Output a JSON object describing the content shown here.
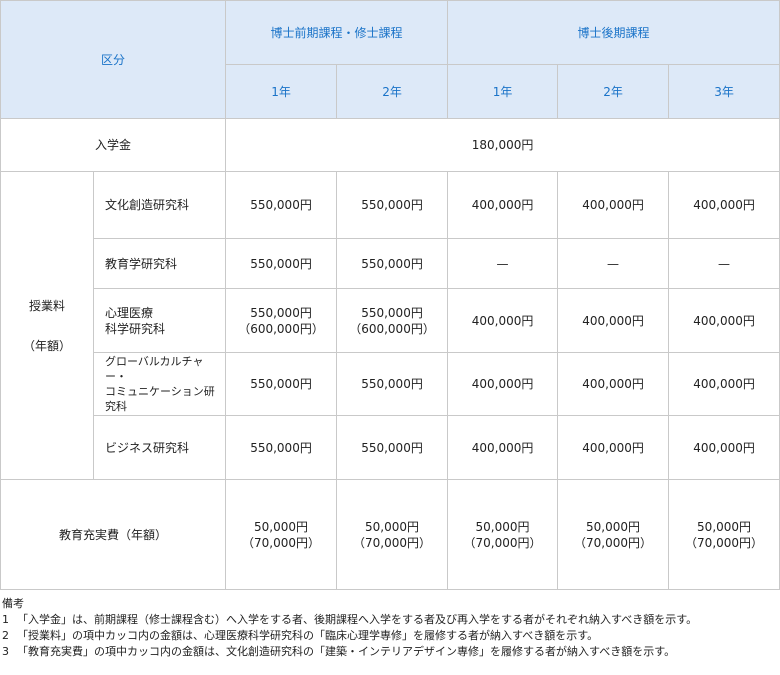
{
  "header": {
    "category": "区分",
    "masters_group": "博士前期課程・修士課程",
    "doctoral_group": "博士後期課程",
    "years": [
      "1年",
      "2年",
      "1年",
      "2年",
      "3年"
    ]
  },
  "admission": {
    "label": "入学金",
    "value": "180,000円"
  },
  "tuition": {
    "label": "授業料",
    "sublabel": "（年額）",
    "rows": [
      {
        "name": "文化創造研究科",
        "cells": [
          {
            "main": "550,000円",
            "alt": ""
          },
          {
            "main": "550,000円",
            "alt": ""
          },
          {
            "main": "400,000円",
            "alt": ""
          },
          {
            "main": "400,000円",
            "alt": ""
          },
          {
            "main": "400,000円",
            "alt": ""
          }
        ]
      },
      {
        "name": "教育学研究科",
        "cells": [
          {
            "main": "550,000円",
            "alt": ""
          },
          {
            "main": "550,000円",
            "alt": ""
          },
          {
            "main": "—",
            "alt": ""
          },
          {
            "main": "—",
            "alt": ""
          },
          {
            "main": "—",
            "alt": ""
          }
        ]
      },
      {
        "name_line1": "心理医療",
        "name_line2": "科学研究科",
        "cells": [
          {
            "main": "550,000円",
            "alt": "（600,000円）"
          },
          {
            "main": "550,000円",
            "alt": "（600,000円）"
          },
          {
            "main": "400,000円",
            "alt": ""
          },
          {
            "main": "400,000円",
            "alt": ""
          },
          {
            "main": "400,000円",
            "alt": ""
          }
        ]
      },
      {
        "name_line1": "グローバルカルチャー・",
        "name_line2": "コミュニケーション研究科",
        "cells": [
          {
            "main": "550,000円",
            "alt": ""
          },
          {
            "main": "550,000円",
            "alt": ""
          },
          {
            "main": "400,000円",
            "alt": ""
          },
          {
            "main": "400,000円",
            "alt": ""
          },
          {
            "main": "400,000円",
            "alt": ""
          }
        ]
      },
      {
        "name": "ビジネス研究科",
        "cells": [
          {
            "main": "550,000円",
            "alt": ""
          },
          {
            "main": "550,000円",
            "alt": ""
          },
          {
            "main": "400,000円",
            "alt": ""
          },
          {
            "main": "400,000円",
            "alt": ""
          },
          {
            "main": "400,000円",
            "alt": ""
          }
        ]
      }
    ]
  },
  "education_fee": {
    "label": "教育充実費（年額）",
    "cells": [
      {
        "main": "50,000円",
        "alt": "（70,000円）"
      },
      {
        "main": "50,000円",
        "alt": "（70,000円）"
      },
      {
        "main": "50,000円",
        "alt": "（70,000円）"
      },
      {
        "main": "50,000円",
        "alt": "（70,000円）"
      },
      {
        "main": "50,000円",
        "alt": "（70,000円）"
      }
    ]
  },
  "notes": {
    "title": "備考",
    "items": [
      {
        "num": "1",
        "text": "「入学金」は、前期課程（修士課程含む）へ入学をする者、後期課程へ入学をする者及び再入学をする者がそれぞれ納入すべき額を示す。"
      },
      {
        "num": "2",
        "text": "「授業料」の項中カッコ内の金額は、心理医療科学研究科の「臨床心理学専修」を履修する者が納入すべき額を示す。"
      },
      {
        "num": "3",
        "text": "「教育充実費」の項中カッコ内の金額は、文化創造研究科の「建築・インテリアデザイン専修」を履修する者が納入すべき額を示す。"
      }
    ]
  }
}
